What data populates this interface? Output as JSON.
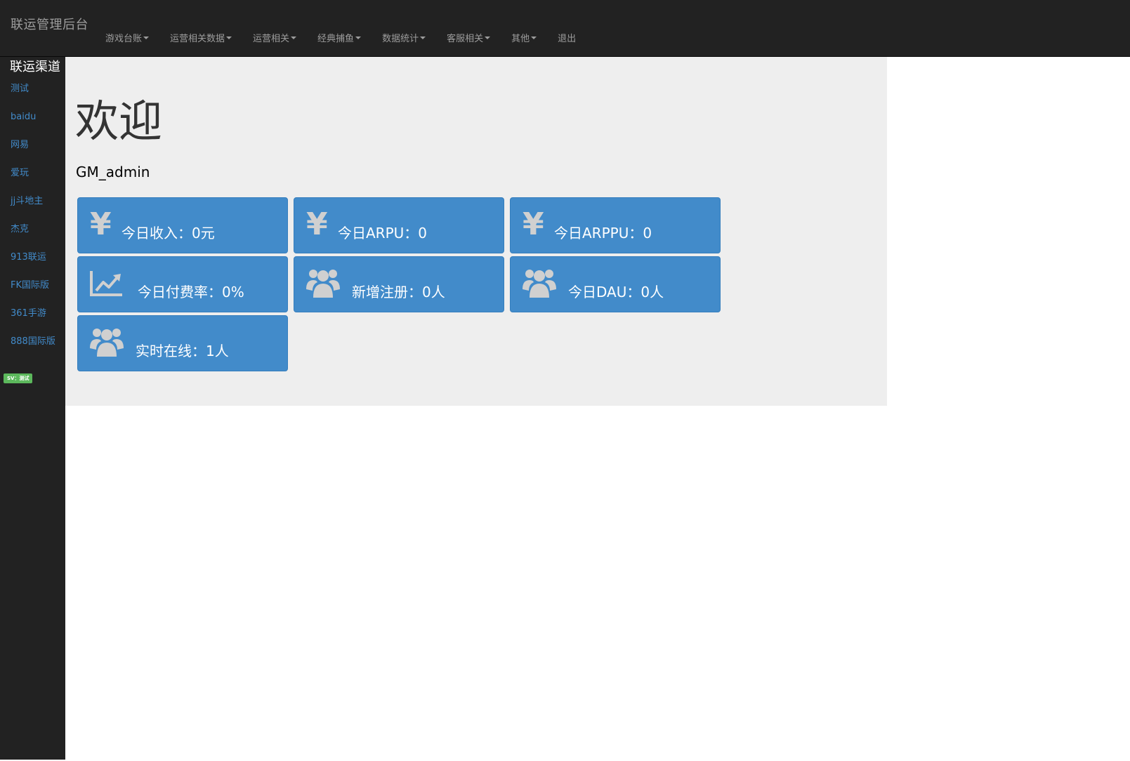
{
  "navbar": {
    "brand": "联运管理后台",
    "items": [
      {
        "label": "游戏台账",
        "dropdown": true
      },
      {
        "label": "运营相关数据",
        "dropdown": true
      },
      {
        "label": "运营相关",
        "dropdown": true
      },
      {
        "label": "经典捕鱼",
        "dropdown": true
      },
      {
        "label": "数据统计",
        "dropdown": true
      },
      {
        "label": "客服相关",
        "dropdown": true
      },
      {
        "label": "其他",
        "dropdown": true
      },
      {
        "label": "退出",
        "dropdown": false
      }
    ]
  },
  "sidebar": {
    "title": "联运渠道",
    "items": [
      {
        "label": "测试"
      },
      {
        "label": "baidu"
      },
      {
        "label": "网易"
      },
      {
        "label": "爱玩"
      },
      {
        "label": "jj斗地主"
      },
      {
        "label": "杰克"
      },
      {
        "label": "913联运"
      },
      {
        "label": "FK国际版"
      },
      {
        "label": "361手游"
      },
      {
        "label": "888国际版"
      }
    ],
    "version_badge": "SV：测试"
  },
  "main": {
    "title": "欢迎",
    "username": "GM_admin",
    "cards": [
      {
        "icon": "yen-icon",
        "label": "今日收入：0元"
      },
      {
        "icon": "yen-icon",
        "label": "今日ARPU：0"
      },
      {
        "icon": "yen-icon",
        "label": "今日ARPPU：0"
      },
      {
        "icon": "line-chart-icon",
        "label": "今日付费率：0%"
      },
      {
        "icon": "users-icon",
        "label": "新增注册：0人"
      },
      {
        "icon": "users-icon",
        "label": "今日DAU：0人"
      },
      {
        "icon": "users-icon",
        "label": "实时在线：1人"
      }
    ]
  },
  "colors": {
    "navbar_bg": "#222222",
    "jumbotron_bg": "#eeeeee",
    "card_bg": "#428bca",
    "link": "#428bca",
    "badge": "#5cb85c"
  }
}
